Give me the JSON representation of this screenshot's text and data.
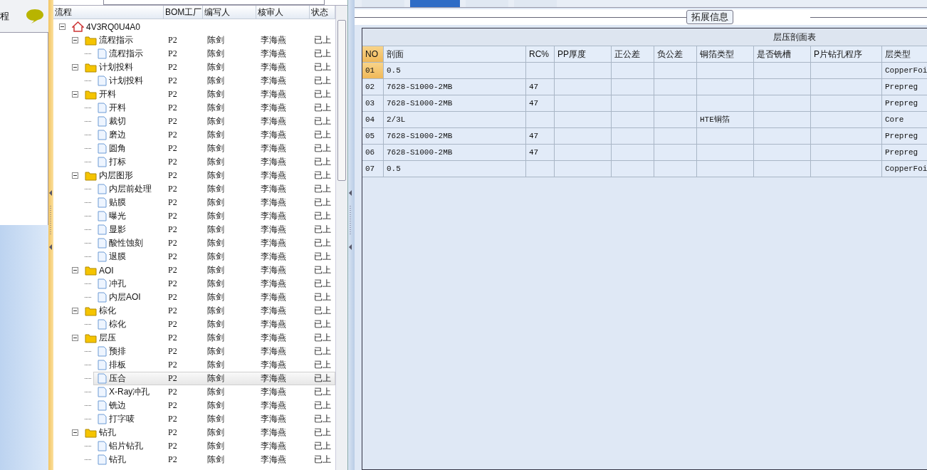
{
  "left_panel": {
    "title": "程"
  },
  "tree": {
    "columns": [
      "流程",
      "BOM工厂",
      "编写人",
      "核审人",
      "状态"
    ],
    "root": {
      "label": "4V3RQ0U4A0",
      "expanded": true,
      "children": [
        {
          "label": "流程指示",
          "bom": "P2",
          "writer": "陈剑",
          "reviewer": "李海燕",
          "status": "已上",
          "expanded": true,
          "children": [
            {
              "label": "流程指示",
              "bom": "P2",
              "writer": "陈剑",
              "reviewer": "李海燕",
              "status": "已上",
              "selected": false
            }
          ]
        },
        {
          "label": "计划投料",
          "bom": "P2",
          "writer": "陈剑",
          "reviewer": "李海燕",
          "status": "已上",
          "expanded": true,
          "children": [
            {
              "label": "计划投料",
              "bom": "P2",
              "writer": "陈剑",
              "reviewer": "李海燕",
              "status": "已上",
              "selected": false
            }
          ]
        },
        {
          "label": "开料",
          "bom": "P2",
          "writer": "陈剑",
          "reviewer": "李海燕",
          "status": "已上",
          "expanded": true,
          "children": [
            {
              "label": "开料",
              "bom": "P2",
              "writer": "陈剑",
              "reviewer": "李海燕",
              "status": "已上",
              "selected": false
            },
            {
              "label": "裁切",
              "bom": "P2",
              "writer": "陈剑",
              "reviewer": "李海燕",
              "status": "已上",
              "selected": false
            },
            {
              "label": "磨边",
              "bom": "P2",
              "writer": "陈剑",
              "reviewer": "李海燕",
              "status": "已上",
              "selected": false
            },
            {
              "label": "圆角",
              "bom": "P2",
              "writer": "陈剑",
              "reviewer": "李海燕",
              "status": "已上",
              "selected": false
            },
            {
              "label": "打标",
              "bom": "P2",
              "writer": "陈剑",
              "reviewer": "李海燕",
              "status": "已上",
              "selected": false
            }
          ]
        },
        {
          "label": "内层图形",
          "bom": "P2",
          "writer": "陈剑",
          "reviewer": "李海燕",
          "status": "已上",
          "expanded": true,
          "children": [
            {
              "label": "内层前处理",
              "bom": "P2",
              "writer": "陈剑",
              "reviewer": "李海燕",
              "status": "已上",
              "selected": false
            },
            {
              "label": "贴膜",
              "bom": "P2",
              "writer": "陈剑",
              "reviewer": "李海燕",
              "status": "已上",
              "selected": false
            },
            {
              "label": "曝光",
              "bom": "P2",
              "writer": "陈剑",
              "reviewer": "李海燕",
              "status": "已上",
              "selected": false
            },
            {
              "label": "显影",
              "bom": "P2",
              "writer": "陈剑",
              "reviewer": "李海燕",
              "status": "已上",
              "selected": false
            },
            {
              "label": "酸性蚀刻",
              "bom": "P2",
              "writer": "陈剑",
              "reviewer": "李海燕",
              "status": "已上",
              "selected": false
            },
            {
              "label": "退膜",
              "bom": "P2",
              "writer": "陈剑",
              "reviewer": "李海燕",
              "status": "已上",
              "selected": false
            }
          ]
        },
        {
          "label": "AOI",
          "bom": "P2",
          "writer": "陈剑",
          "reviewer": "李海燕",
          "status": "已上",
          "expanded": true,
          "children": [
            {
              "label": "冲孔",
              "bom": "P2",
              "writer": "陈剑",
              "reviewer": "李海燕",
              "status": "已上",
              "selected": false
            },
            {
              "label": "内层AOI",
              "bom": "P2",
              "writer": "陈剑",
              "reviewer": "李海燕",
              "status": "已上",
              "selected": false
            }
          ]
        },
        {
          "label": "棕化",
          "bom": "P2",
          "writer": "陈剑",
          "reviewer": "李海燕",
          "status": "已上",
          "expanded": true,
          "children": [
            {
              "label": "棕化",
              "bom": "P2",
              "writer": "陈剑",
              "reviewer": "李海燕",
              "status": "已上",
              "selected": false
            }
          ]
        },
        {
          "label": "层压",
          "bom": "P2",
          "writer": "陈剑",
          "reviewer": "李海燕",
          "status": "已上",
          "expanded": true,
          "children": [
            {
              "label": "预排",
              "bom": "P2",
              "writer": "陈剑",
              "reviewer": "李海燕",
              "status": "已上",
              "selected": false
            },
            {
              "label": "排板",
              "bom": "P2",
              "writer": "陈剑",
              "reviewer": "李海燕",
              "status": "已上",
              "selected": false
            },
            {
              "label": "压合",
              "bom": "P2",
              "writer": "陈剑",
              "reviewer": "李海燕",
              "status": "已上",
              "selected": true
            },
            {
              "label": "X-Ray冲孔",
              "bom": "P2",
              "writer": "陈剑",
              "reviewer": "李海燕",
              "status": "已上",
              "selected": false
            },
            {
              "label": "铣边",
              "bom": "P2",
              "writer": "陈剑",
              "reviewer": "李海燕",
              "status": "已上",
              "selected": false
            },
            {
              "label": "打字唛",
              "bom": "P2",
              "writer": "陈剑",
              "reviewer": "李海燕",
              "status": "已上",
              "selected": false
            }
          ]
        },
        {
          "label": "钻孔",
          "bom": "P2",
          "writer": "陈剑",
          "reviewer": "李海燕",
          "status": "已上",
          "expanded": true,
          "children": [
            {
              "label": "铝片钻孔",
              "bom": "P2",
              "writer": "陈剑",
              "reviewer": "李海燕",
              "status": "已上",
              "selected": false
            },
            {
              "label": "钻孔",
              "bom": "P2",
              "writer": "陈剑",
              "reviewer": "李海燕",
              "status": "已上",
              "selected": false
            }
          ]
        }
      ]
    }
  },
  "tabs": [
    {
      "selected": false
    },
    {
      "selected": true
    },
    {
      "selected": false
    },
    {
      "selected": false
    }
  ],
  "group": {
    "title": "拓展信息"
  },
  "table": {
    "title": "层压剖面表",
    "columns": [
      "NO",
      "剖面",
      "RC%",
      "PP厚度",
      "正公差",
      "负公差",
      "铜箔类型",
      "是否铣槽",
      "P片钻孔程序",
      "层类型"
    ],
    "rows": [
      {
        "selected": true,
        "cells": [
          "01",
          "0.5",
          "",
          "",
          "",
          "",
          "",
          "",
          "",
          "CopperFoi"
        ]
      },
      {
        "selected": false,
        "cells": [
          "02",
          "7628-S1000-2MB",
          "47",
          "",
          "",
          "",
          "",
          "",
          "",
          "Prepreg"
        ]
      },
      {
        "selected": false,
        "cells": [
          "03",
          "7628-S1000-2MB",
          "47",
          "",
          "",
          "",
          "",
          "",
          "",
          "Prepreg"
        ]
      },
      {
        "selected": false,
        "cells": [
          "04",
          "2/3L",
          "",
          "",
          "",
          "",
          "HTE铜箔",
          "",
          "",
          "Core"
        ]
      },
      {
        "selected": false,
        "cells": [
          "05",
          "7628-S1000-2MB",
          "47",
          "",
          "",
          "",
          "",
          "",
          "",
          "Prepreg"
        ]
      },
      {
        "selected": false,
        "cells": [
          "06",
          "7628-S1000-2MB",
          "47",
          "",
          "",
          "",
          "",
          "",
          "",
          "Prepreg"
        ]
      },
      {
        "selected": false,
        "cells": [
          "07",
          "0.5",
          "",
          "",
          "",
          "",
          "",
          "",
          "",
          "CopperFoi"
        ]
      }
    ]
  }
}
